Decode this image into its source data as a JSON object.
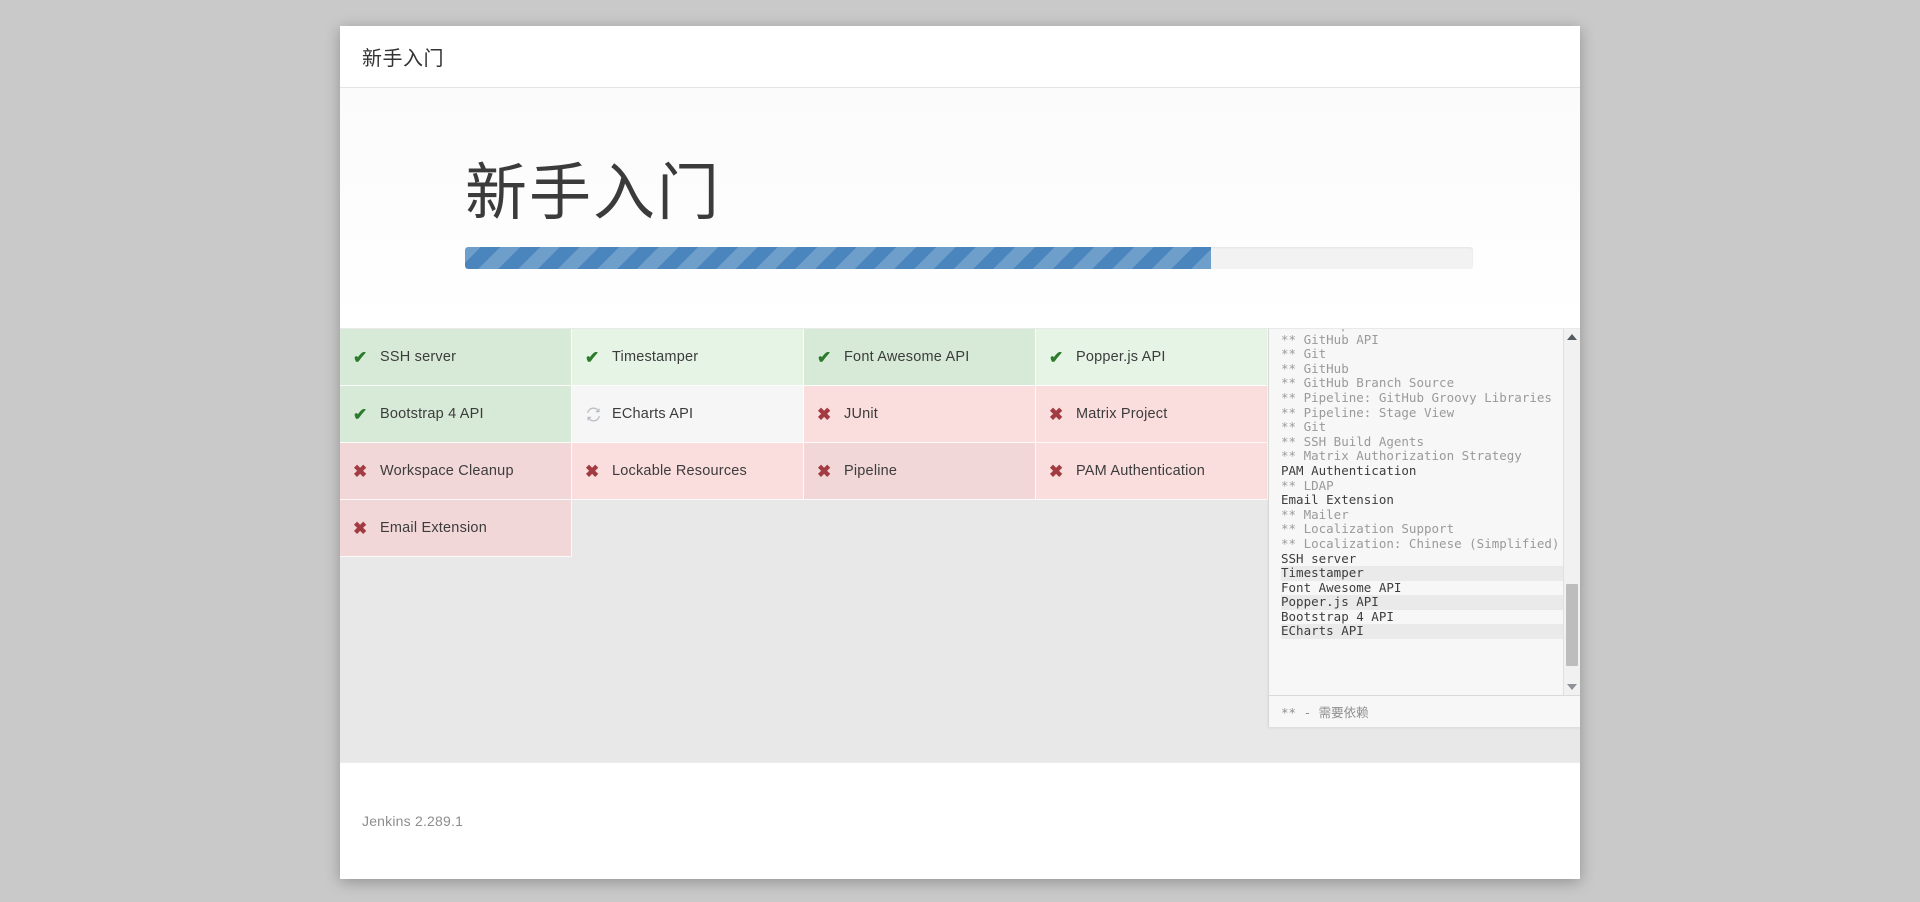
{
  "dialog": {
    "header_title": "新手入门",
    "hero_title": "新手入门"
  },
  "progress": {
    "percent": 74,
    "fill_color": "#4a86bd",
    "track_color": "#f2f2f2"
  },
  "plugin_tiles": [
    {
      "label": "SSH server",
      "icon": "check-icon",
      "state": "success-a"
    },
    {
      "label": "Timestamper",
      "icon": "check-icon",
      "state": "success-b"
    },
    {
      "label": "Font Awesome API",
      "icon": "check-icon",
      "state": "success-a"
    },
    {
      "label": "Popper.js API",
      "icon": "check-icon",
      "state": "success-b"
    },
    {
      "label": "Bootstrap 4 API",
      "icon": "check-icon",
      "state": "success-a"
    },
    {
      "label": "ECharts API",
      "icon": "spinner-icon",
      "state": "pending"
    },
    {
      "label": "JUnit",
      "icon": "cross-icon",
      "state": "fail-b"
    },
    {
      "label": "Matrix Project",
      "icon": "cross-icon",
      "state": "fail-b"
    },
    {
      "label": "Workspace Cleanup",
      "icon": "cross-icon",
      "state": "fail-a"
    },
    {
      "label": "Lockable Resources",
      "icon": "cross-icon",
      "state": "fail-b"
    },
    {
      "label": "Pipeline",
      "icon": "cross-icon",
      "state": "fail-a"
    },
    {
      "label": "PAM Authentication",
      "icon": "cross-icon",
      "state": "fail-b"
    },
    {
      "label": "Email Extension",
      "icon": "cross-icon",
      "state": "fail-a"
    }
  ],
  "install_log": {
    "lines": [
      {
        "text": "** OkHttp",
        "kind": "dep",
        "highlight": false
      },
      {
        "text": "** GitHub API",
        "kind": "dep",
        "highlight": false
      },
      {
        "text": "** Git",
        "kind": "dep",
        "highlight": false
      },
      {
        "text": "** GitHub",
        "kind": "dep",
        "highlight": false
      },
      {
        "text": "** GitHub Branch Source",
        "kind": "dep",
        "highlight": false
      },
      {
        "text": "** Pipeline: GitHub Groovy Libraries",
        "kind": "dep",
        "highlight": false
      },
      {
        "text": "** Pipeline: Stage View",
        "kind": "dep",
        "highlight": false
      },
      {
        "text": "** Git",
        "kind": "dep",
        "highlight": false
      },
      {
        "text": "** SSH Build Agents",
        "kind": "dep",
        "highlight": false
      },
      {
        "text": "** Matrix Authorization Strategy",
        "kind": "dep",
        "highlight": false
      },
      {
        "text": "PAM Authentication",
        "kind": "top",
        "highlight": false
      },
      {
        "text": "** LDAP",
        "kind": "dep",
        "highlight": false
      },
      {
        "text": "Email Extension",
        "kind": "top",
        "highlight": false
      },
      {
        "text": "** Mailer",
        "kind": "dep",
        "highlight": false
      },
      {
        "text": "** Localization Support",
        "kind": "dep",
        "highlight": false
      },
      {
        "text": "** Localization: Chinese (Simplified)",
        "kind": "dep",
        "highlight": false
      },
      {
        "text": "SSH server",
        "kind": "top",
        "highlight": false
      },
      {
        "text": "Timestamper",
        "kind": "top",
        "highlight": true
      },
      {
        "text": "Font Awesome API",
        "kind": "top",
        "highlight": false
      },
      {
        "text": "Popper.js API",
        "kind": "top",
        "highlight": true
      },
      {
        "text": "Bootstrap 4 API",
        "kind": "top",
        "highlight": false
      },
      {
        "text": "ECharts API",
        "kind": "top",
        "highlight": true
      }
    ],
    "legend": "** - 需要依赖"
  },
  "footer": {
    "version": "Jenkins 2.289.1"
  }
}
